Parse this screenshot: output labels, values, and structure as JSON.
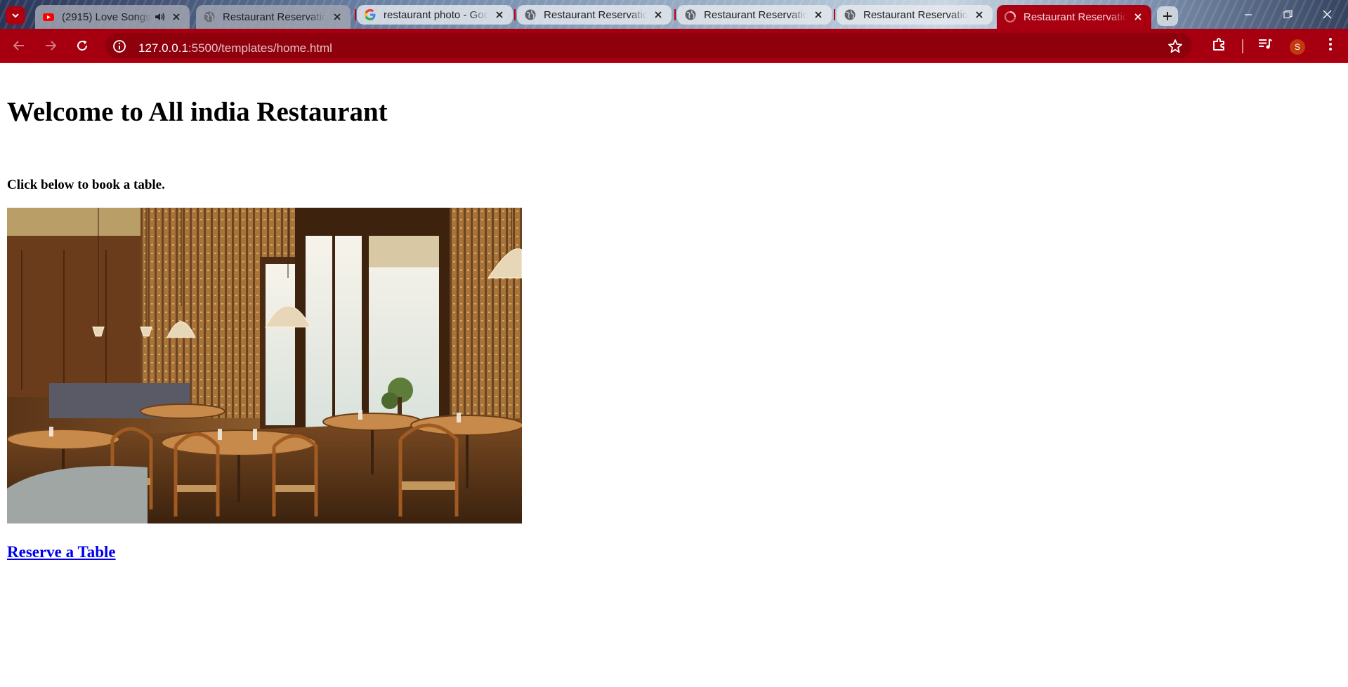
{
  "browser": {
    "tabs": [
      {
        "title": "(2915) Love Songs",
        "favicon": "youtube-icon",
        "audio": true
      },
      {
        "title": "Restaurant Reservation",
        "favicon": "globe-icon"
      },
      {
        "title": "restaurant photo - Google",
        "favicon": "google-icon"
      },
      {
        "title": "Restaurant Reservation",
        "favicon": "globe-icon"
      },
      {
        "title": "Restaurant Reservation",
        "favicon": "globe-icon"
      },
      {
        "title": "Restaurant Reservation",
        "favicon": "globe-icon"
      },
      {
        "title": "Restaurant Reservation",
        "favicon": "globe-icon",
        "active": true
      }
    ],
    "address": {
      "host": "127.0.0.1",
      "path": ":5500/templates/home.html"
    },
    "profile_initial": "S",
    "accent_color": "#a60010"
  },
  "page": {
    "heading": "Welcome to All india Restaurant",
    "subtext": "Click below to book a table.",
    "image_subject": "restaurant dining room interior",
    "link_text": "Reserve a Table"
  }
}
